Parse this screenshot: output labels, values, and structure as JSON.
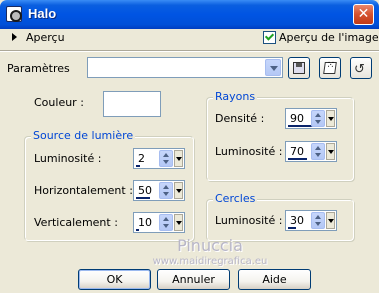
{
  "window": {
    "title": "Halo"
  },
  "preview": {
    "label": "Aperçu",
    "checkbox_label": "Aperçu de l'image",
    "checked": true
  },
  "presets": {
    "label": "Paramètres",
    "value": ""
  },
  "couleur": {
    "label": "Couleur :",
    "value": "#ffffff"
  },
  "source": {
    "title": "Source de lumière",
    "luminosite": {
      "label": "Luminosité :",
      "value": "2"
    },
    "horizontal": {
      "label": "Horizontalement :",
      "value": "50"
    },
    "vertical": {
      "label": "Verticalement :",
      "value": "10"
    }
  },
  "rayons": {
    "title": "Rayons",
    "densite": {
      "label": "Densité :",
      "value": "90"
    },
    "luminosite": {
      "label": "Luminosité :",
      "value": "70"
    }
  },
  "cercles": {
    "title": "Cercles",
    "luminosite": {
      "label": "Luminosité :",
      "value": "30"
    }
  },
  "watermark": {
    "name": "Pinuccia",
    "site": "www.maidiregrafica.eu"
  },
  "buttons": {
    "ok": "OK",
    "cancel": "Annuler",
    "help": "Aide"
  }
}
